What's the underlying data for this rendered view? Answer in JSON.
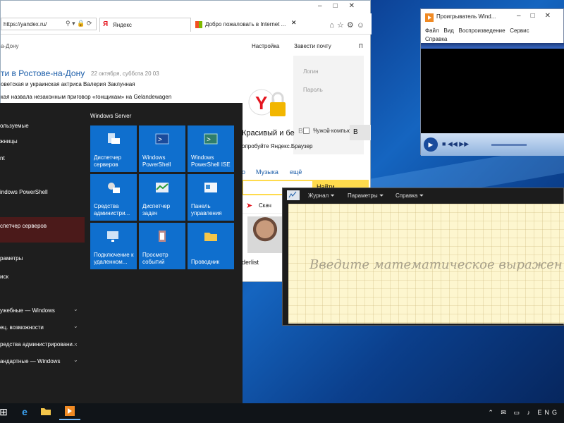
{
  "browser": {
    "url": "https://yandex.ru/",
    "tabs": [
      {
        "label": "Яндекс",
        "active": true
      },
      {
        "label": "Добро пожаловать в Internet ...",
        "active": false
      }
    ],
    "city_breadcrumb": "а-Дону",
    "top_links": [
      "Настройка",
      "Завести почту",
      "П"
    ],
    "news_head": "ти  в Ростове-на-Дону",
    "news_date": "22 октября, суббота 20 03",
    "news_lines": [
      "оветская и украинская актриса Валерия Заклунная",
      "кая назвала незаконным приговор «гонщикам» на Gelandewagen"
    ],
    "login": {
      "login_placeholder": "Логин",
      "password_placeholder": "Пароль",
      "remember_label": "Чужой компьютер"
    },
    "promo_title": "Красивый и бе",
    "promo_text": "опробуйте Яндекс.Браузер",
    "promo_button": "В",
    "services": [
      "о",
      "Музыка",
      "ещё"
    ],
    "find_button": "Найти",
    "download_label": "Скач",
    "caption": "derlist"
  },
  "start_menu": {
    "items": [
      {
        "label": "ользуемые",
        "chevron": false
      },
      {
        "label": "жницы",
        "chevron": false
      },
      {
        "label": "nt",
        "chevron": false
      },
      {
        "label": "indows PowerShell",
        "chevron": false
      },
      {
        "label": "спетчер серверов",
        "chevron": false
      },
      {
        "label": "раметры",
        "chevron": false
      },
      {
        "label": "иск",
        "chevron": false
      },
      {
        "label": "ужебные — Windows",
        "chevron": true
      },
      {
        "label": "ец. возможности",
        "chevron": true
      },
      {
        "label": "редства администрировани...",
        "chevron": true
      },
      {
        "label": "андартные — Windows",
        "chevron": true
      }
    ],
    "group_title": "Windows Server",
    "tiles": [
      {
        "label": "Диспетчер серверов",
        "icon": "server-manager-icon"
      },
      {
        "label": "Windows PowerShell",
        "icon": "powershell-icon"
      },
      {
        "label": "Windows PowerShell ISE",
        "icon": "powershell-ise-icon"
      },
      {
        "label": "Средства администри...",
        "icon": "admin-tools-icon"
      },
      {
        "label": "Диспетчер задач",
        "icon": "task-manager-icon"
      },
      {
        "label": "Панель управления",
        "icon": "control-panel-icon"
      },
      {
        "label": "Подключение к удаленном...",
        "icon": "remote-desktop-icon"
      },
      {
        "label": "Просмотр событий",
        "icon": "event-viewer-icon"
      },
      {
        "label": "Проводник",
        "icon": "folder-icon"
      }
    ]
  },
  "media_player": {
    "title": "Проигрыватель Wind...",
    "menu_row1": [
      "Файл",
      "Вид",
      "Воспроизведение",
      "Сервис"
    ],
    "menu_row2": [
      "Справка"
    ]
  },
  "math_panel": {
    "menu": [
      "Журнал",
      "Параметры",
      "Справка"
    ],
    "placeholder": "Введите математическое выражен"
  },
  "taskbar": {
    "items": [
      "start-icon",
      "ie-icon",
      "file-explorer-icon",
      "media-player-icon"
    ],
    "language": "ENG"
  }
}
